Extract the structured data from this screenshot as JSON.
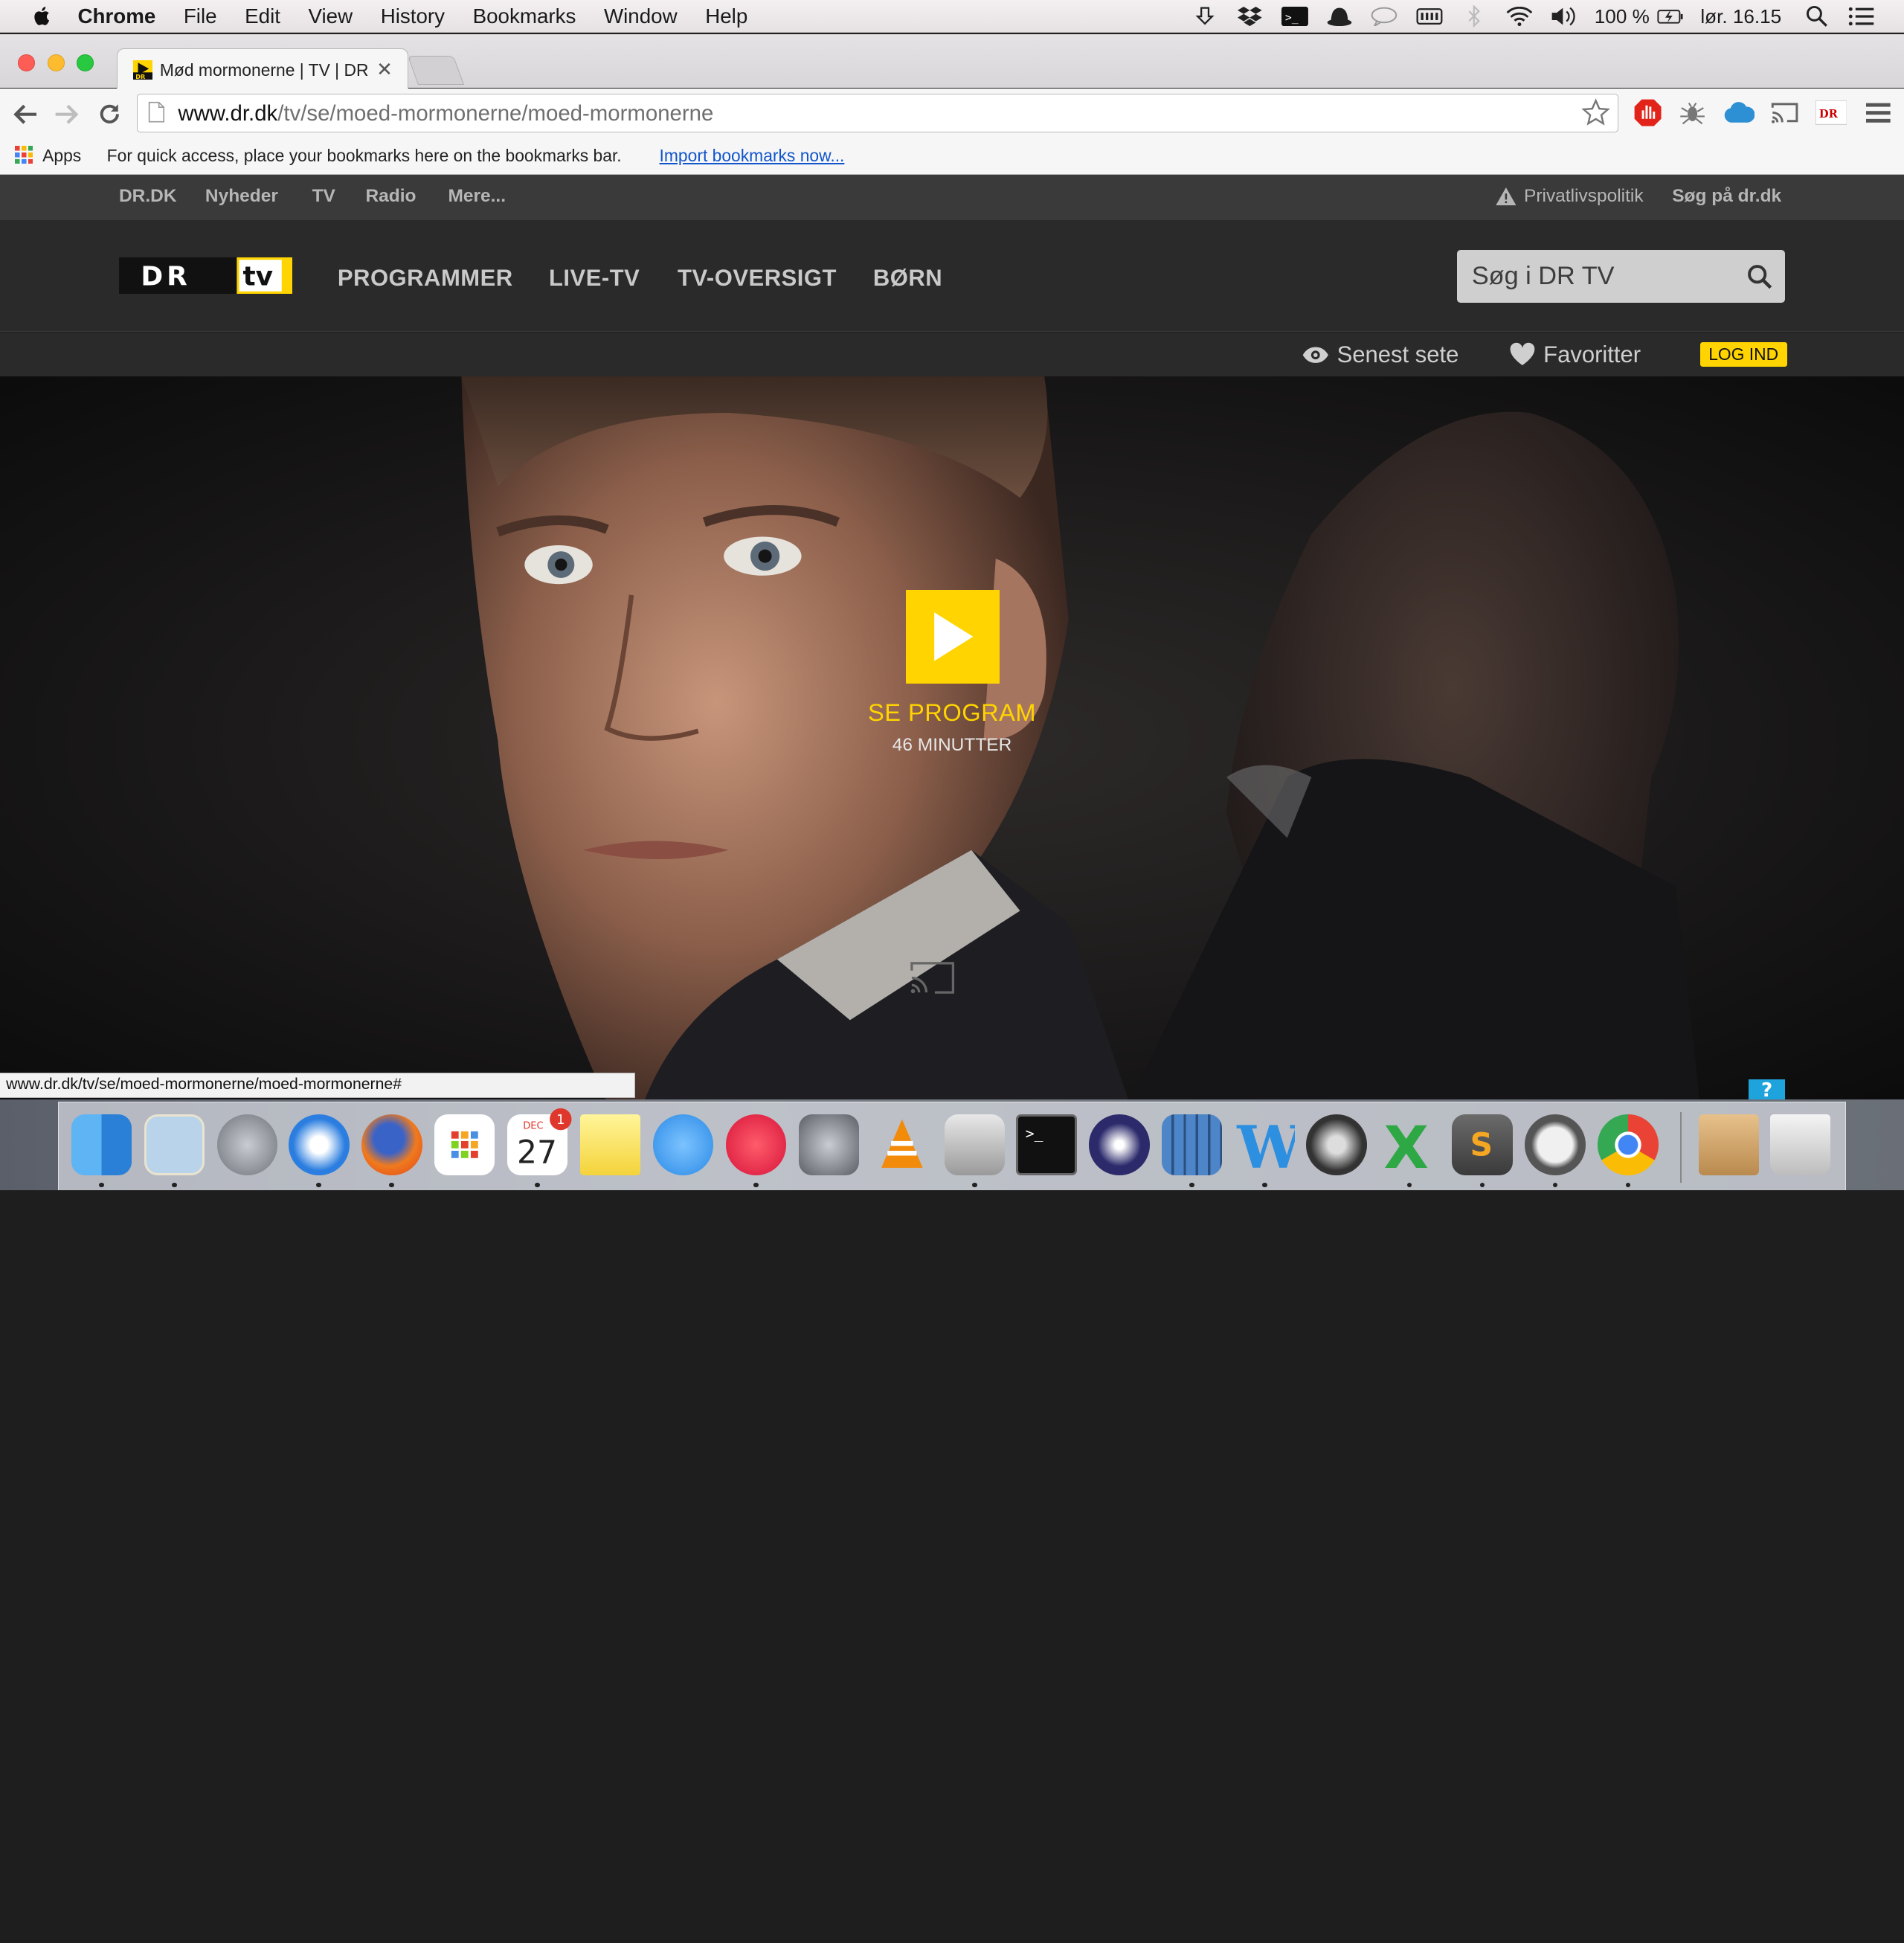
{
  "menubar": {
    "app_name": "Chrome",
    "menus": [
      "File",
      "Edit",
      "View",
      "History",
      "Bookmarks",
      "Window",
      "Help"
    ],
    "battery": "100 %",
    "clock": "lør. 16.15"
  },
  "browser": {
    "tab_title": "Mød mormonerne | TV | DR",
    "url_domain": "www.dr.dk",
    "url_path": "/tv/se/moed-mormonerne/moed-mormonerne",
    "bookmarks_apps": "Apps",
    "bookmarks_hint": "For quick access, place your bookmarks here on the bookmarks bar.",
    "bookmarks_import": "Import bookmarks now...",
    "status_url": "www.dr.dk/tv/se/moed-mormonerne/moed-mormonerne#"
  },
  "dr_topnav": {
    "items": [
      "DR.DK",
      "Nyheder",
      "TV",
      "Radio",
      "Mere..."
    ],
    "privacy": "Privatlivspolitik",
    "search_site": "Søg på dr.dk"
  },
  "dr_header": {
    "logo_dr": "DR",
    "logo_tv": "tv",
    "nav": [
      "PROGRAMMER",
      "LIVE-TV",
      "TV-OVERSIGT",
      "BØRN"
    ],
    "search_placeholder": "Søg i DR TV"
  },
  "dr_subbar": {
    "recent": "Senest sete",
    "favorites": "Favoritter",
    "login": "LOG IND"
  },
  "hero": {
    "cta": "SE PROGRAM",
    "duration": "46 MINUTTER",
    "help_badge": "?"
  },
  "dock": {
    "calendar_month": "DEC",
    "calendar_day": "27",
    "calendar_badge": "1"
  },
  "colors": {
    "dr_yellow": "#ffd400",
    "dr_dark": "#2a2a2a",
    "link_blue": "#1155cc"
  }
}
